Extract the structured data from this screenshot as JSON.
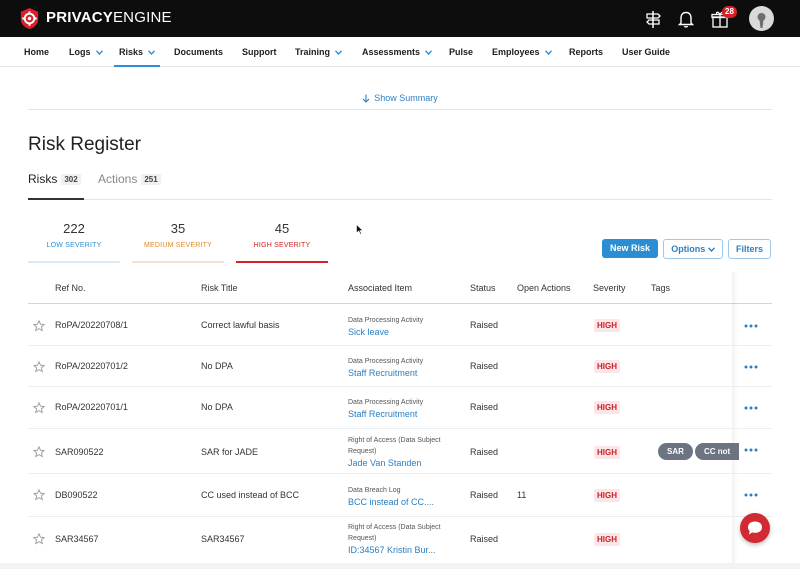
{
  "brand": {
    "name_bold": "PRIVACY",
    "name_thin": "ENGINE"
  },
  "header": {
    "gift_badge": "28"
  },
  "nav": {
    "items": [
      {
        "label": "Home"
      },
      {
        "label": "Logs"
      },
      {
        "label": "Risks"
      },
      {
        "label": "Documents"
      },
      {
        "label": "Support"
      },
      {
        "label": "Training"
      },
      {
        "label": "Assessments"
      },
      {
        "label": "Pulse"
      },
      {
        "label": "Employees"
      },
      {
        "label": "Reports"
      },
      {
        "label": "User Guide"
      }
    ]
  },
  "summary": {
    "label": "Show Summary"
  },
  "page": {
    "title": "Risk Register"
  },
  "tabs": [
    {
      "label": "Risks",
      "count": "302"
    },
    {
      "label": "Actions",
      "count": "251"
    }
  ],
  "severity": [
    {
      "count": "222",
      "label": "LOW SEVERITY",
      "color": "#2a8fd6"
    },
    {
      "count": "35",
      "label": "MEDIUM SEVERITY",
      "color": "#e08a2c"
    },
    {
      "count": "45",
      "label": "HIGH SEVERITY",
      "color": "#d6202a"
    }
  ],
  "buttons": {
    "new_risk": "New Risk",
    "options": "Options",
    "filters": "Filters"
  },
  "table": {
    "headers": [
      "Ref No.",
      "Risk Title",
      "Associated Item",
      "Status",
      "Open Actions",
      "Severity",
      "Tags"
    ],
    "rows": [
      {
        "ref": "RoPA/20220708/1",
        "title": "Correct lawful basis",
        "assoc_type": "Data Processing Activity",
        "assoc_type2": "",
        "assoc_link": "Sick leave",
        "status": "Raised",
        "open_actions": "",
        "severity": "HIGH",
        "tags": []
      },
      {
        "ref": "RoPA/20220701/2",
        "title": "No DPA",
        "assoc_type": "Data Processing Activity",
        "assoc_type2": "",
        "assoc_link": "Staff Recruitment",
        "status": "Raised",
        "open_actions": "",
        "severity": "HIGH",
        "tags": []
      },
      {
        "ref": "RoPA/20220701/1",
        "title": "No DPA",
        "assoc_type": "Data Processing Activity",
        "assoc_type2": "",
        "assoc_link": "Staff Recruitment",
        "status": "Raised",
        "open_actions": "",
        "severity": "HIGH",
        "tags": []
      },
      {
        "ref": "SAR090522",
        "title": "SAR for JADE",
        "assoc_type": "Right of Access (Data Subject",
        "assoc_type2": "Request)",
        "assoc_link": "Jade Van Standen",
        "status": "Raised",
        "open_actions": "",
        "severity": "HIGH",
        "tags": [
          "SAR",
          "CC not"
        ]
      },
      {
        "ref": "DB090522",
        "title": "CC used instead of BCC",
        "assoc_type": "Data Breach Log",
        "assoc_type2": "",
        "assoc_link": "BCC instead of CC....",
        "status": "Raised",
        "open_actions": "11",
        "severity": "HIGH",
        "tags": []
      },
      {
        "ref": "SAR34567",
        "title": "SAR34567",
        "assoc_type": "Right of Access (Data Subject",
        "assoc_type2": "Request)",
        "assoc_link": "ID:34567 Kristin Bur...",
        "status": "Raised",
        "open_actions": "",
        "severity": "HIGH",
        "tags": []
      }
    ]
  },
  "colors": {
    "accent": "#2a8fd6",
    "brand_red": "#d6202a",
    "topbar": "#0d0d0d"
  },
  "icons": [
    "logo-icon",
    "signpost-icon",
    "bell-icon",
    "gift-icon",
    "avatar",
    "chevron-down-icon",
    "arrow-down-icon",
    "star-icon",
    "more-icon",
    "chat-icon",
    "cursor-icon"
  ]
}
